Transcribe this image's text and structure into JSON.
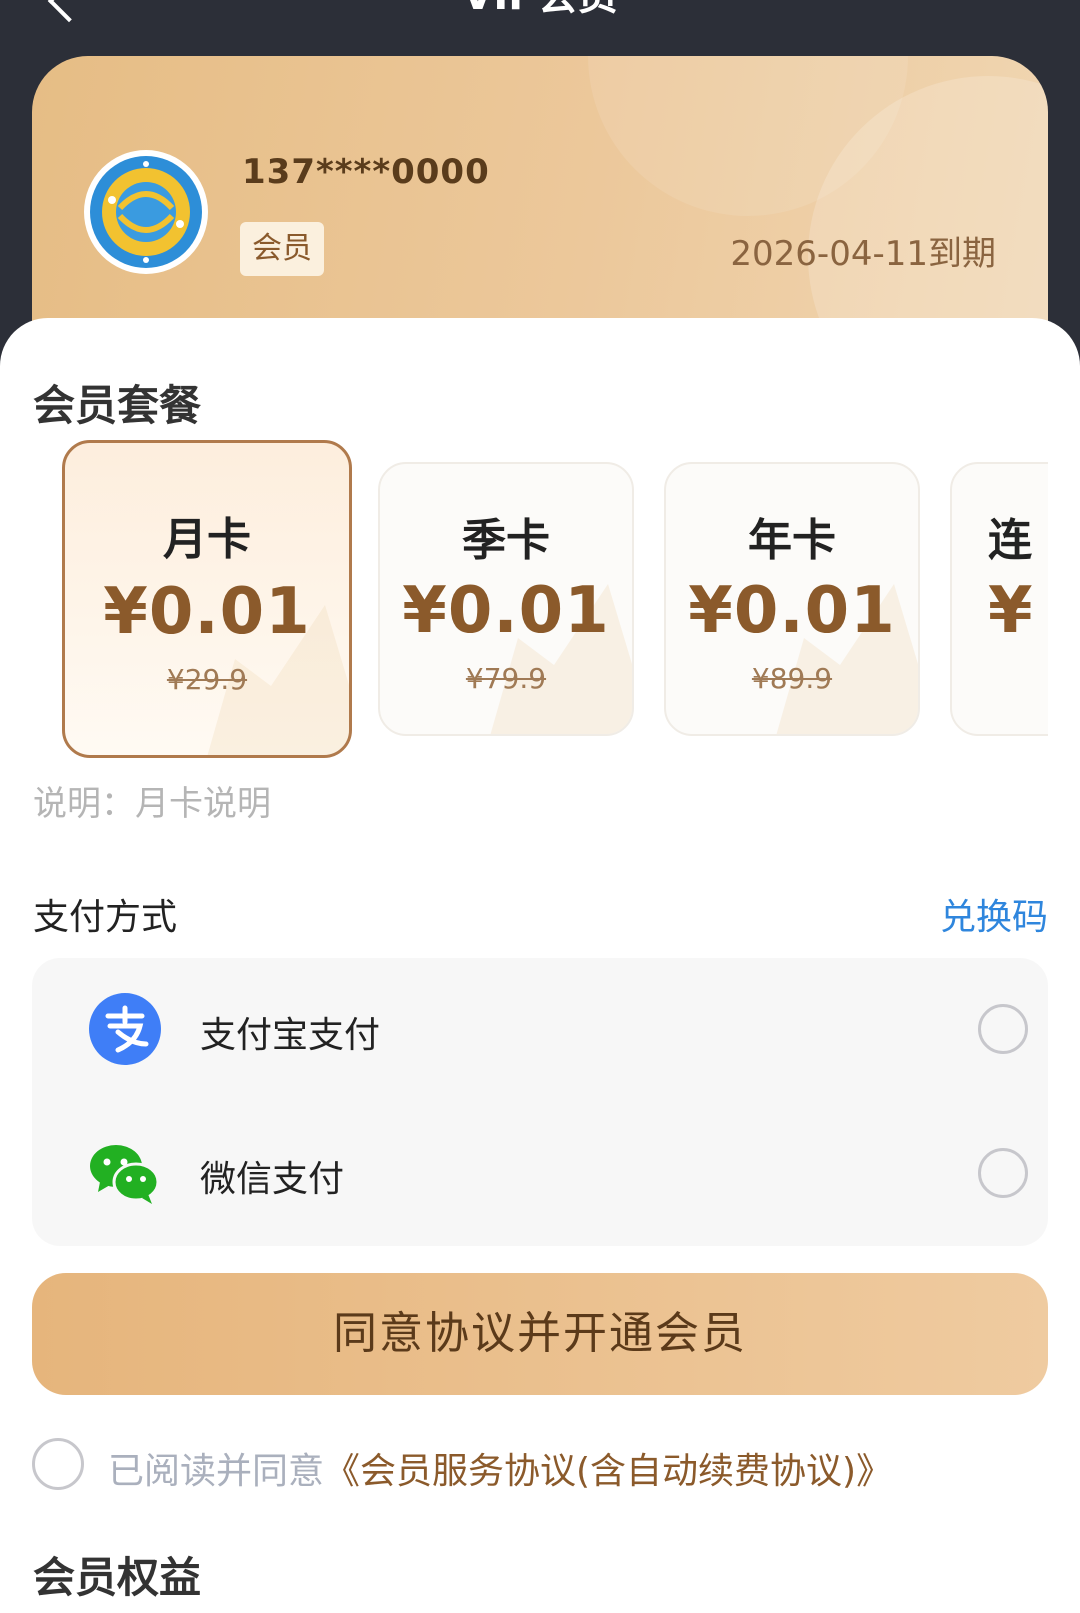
{
  "topbar": {
    "title": "VIP会员"
  },
  "member": {
    "phone": "137****0000",
    "badge": "会员",
    "expire": "2026-04-11到期"
  },
  "plans_section": {
    "title": "会员套餐"
  },
  "plans": [
    {
      "name": "月卡",
      "price": "¥0.01",
      "original": "¥29.9",
      "selected": true
    },
    {
      "name": "季卡",
      "price": "¥0.01",
      "original": "¥79.9",
      "selected": false
    },
    {
      "name": "年卡",
      "price": "¥0.01",
      "original": "¥89.9",
      "selected": false
    },
    {
      "name": "连",
      "price": "¥",
      "original": "",
      "selected": false
    }
  ],
  "plan_description": "说明：月卡说明",
  "payment": {
    "title": "支付方式",
    "redeem_label": "兑换码",
    "methods": [
      {
        "label": "支付宝支付",
        "icon": "alipay-icon",
        "color": "#3f7ef7"
      },
      {
        "label": "微信支付",
        "icon": "wechat-icon",
        "color": "#22b022"
      }
    ]
  },
  "cta_label": "同意协议并开通会员",
  "agreement": {
    "prefix": "已阅读并同意",
    "link": "《会员服务协议(含自动续费协议)》"
  },
  "rights": {
    "title": "会员权益"
  }
}
